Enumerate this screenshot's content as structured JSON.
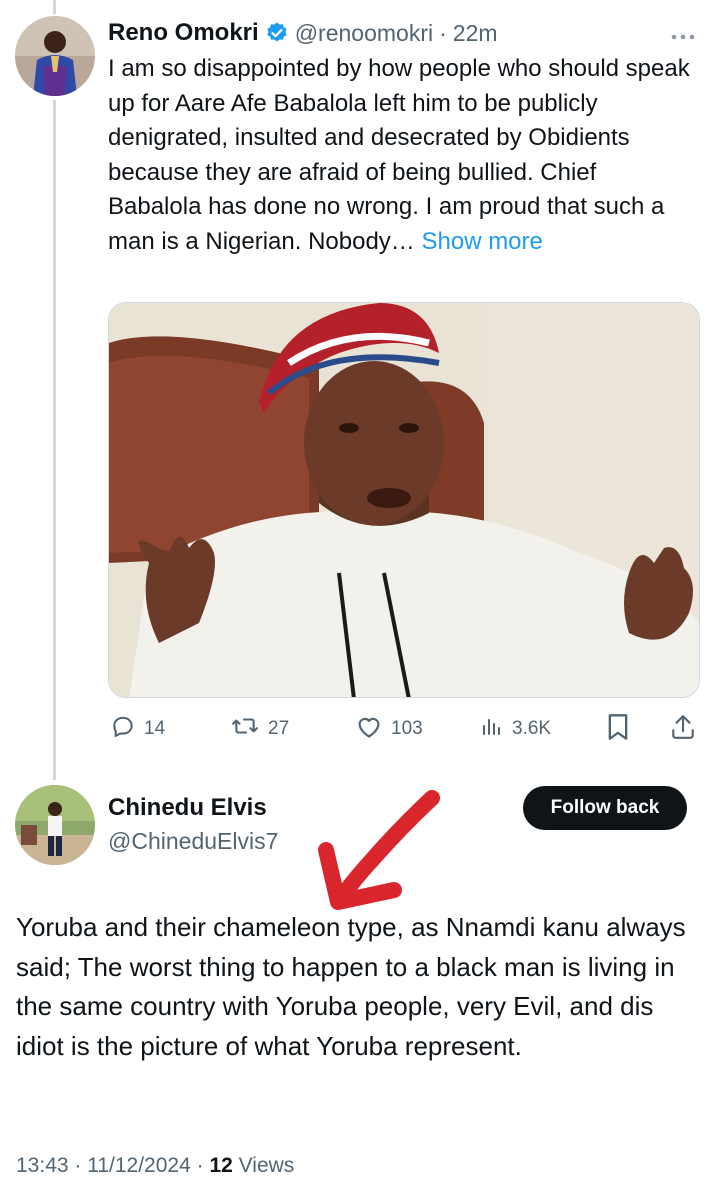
{
  "tweet": {
    "author_name": "Reno Omokri",
    "handle": "@renoomokri",
    "separator": "·",
    "time": "22m",
    "more_icon": "ellipsis-icon",
    "text": "I am so disappointed by how people who should speak up for Aare Afe Babalola left him to be publicly denigrated, insulted and desecrated by Obidients because they are afraid of being bullied. Chief Babalola has done no wrong. I am proud that such a man is a Nigerian. Nobody…",
    "show_more": "Show more",
    "actions": {
      "replies": "14",
      "reposts": "27",
      "likes": "103",
      "views": "3.6K"
    },
    "colors": {
      "verified": "#1d9bf0",
      "link": "#1d9bf0"
    }
  },
  "reply": {
    "author_name": "Chinedu Elvis",
    "handle": "@ChineduElvis7",
    "follow_label": "Follow back",
    "text": "Yoruba and their chameleon type, as Nnamdi kanu always said; The worst thing to happen to a black man is living in the same country with Yoruba people, very Evil, and dis idiot is the picture of what Yoruba represent.",
    "footer": {
      "time": "13:43",
      "sep1": " · ",
      "date": "11/12/2024",
      "sep2": " · ",
      "views_count": "12",
      "views_label": " Views"
    }
  },
  "annotation": {
    "arrow_color": "#d9262c"
  }
}
